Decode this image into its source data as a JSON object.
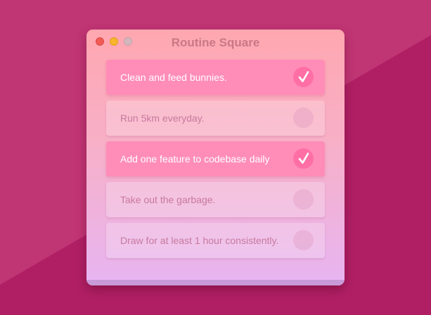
{
  "window": {
    "title": "Routine Square"
  },
  "colors": {
    "accent": "#ff6fa6",
    "done_row": "#ff8db8",
    "background": "#b01f64"
  },
  "tasks": [
    {
      "label": "Clean and feed bunnies.",
      "done": true,
      "icon": "checkmark-icon"
    },
    {
      "label": "Run 5km everyday.",
      "done": false,
      "icon": ""
    },
    {
      "label": "Add one feature to codebase daily",
      "done": true,
      "icon": "checkmark-icon"
    },
    {
      "label": "Take out the garbage.",
      "done": false,
      "icon": ""
    },
    {
      "label": "Draw for at least 1 hour consistently.",
      "done": false,
      "icon": ""
    }
  ]
}
